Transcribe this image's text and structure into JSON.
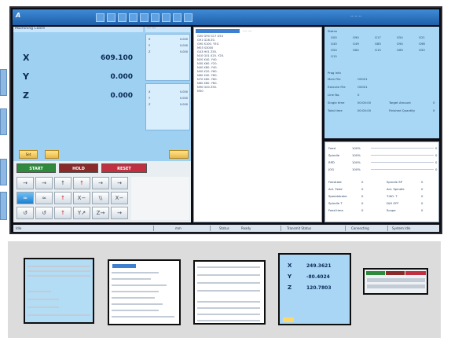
{
  "window": {
    "brand": "A",
    "toolbar_buttons": [
      "",
      "",
      "",
      "",
      "",
      "",
      "",
      "",
      ""
    ],
    "title_right": "-- -- --"
  },
  "coords": {
    "header": "Machining Coord",
    "header_right": "--- ---",
    "axes": [
      {
        "name": "X",
        "value": "609.100"
      },
      {
        "name": "Y",
        "value": "0.000"
      },
      {
        "name": "Z",
        "value": "0.000"
      }
    ],
    "sub_upper": [
      {
        "k": "X",
        "v": "0.000"
      },
      {
        "k": "Y",
        "v": "0.000"
      },
      {
        "k": "Z",
        "v": "0.000"
      }
    ],
    "sub_lower": [
      {
        "k": "X",
        "v": "0.000"
      },
      {
        "k": "Y",
        "v": "0.000"
      },
      {
        "k": "Z",
        "v": "0.000"
      }
    ],
    "btn_left1": "Set",
    "btn_left2": "",
    "btn_right": ""
  },
  "control": {
    "start": "START",
    "hold": "HOLD",
    "reset": "RESET",
    "grid_row1": [
      "→",
      "→",
      "↑",
      "↑",
      "→",
      "→"
    ],
    "grid_row2": [
      "≈",
      "≈",
      "↑",
      "X−",
      "\\\\",
      "X−"
    ],
    "grid_row3": [
      "↺",
      "↺",
      "↑",
      "Y↗",
      "Z→",
      "→"
    ]
  },
  "program": {
    "header": "---- ----",
    "lines": [
      "G00 G90 G17 G54",
      "G91 G28 Z0.",
      "G90 X100. Y50.",
      "M03 S3000",
      "G43 H01 Z50.",
      "N10 G01 X20. Y20.",
      "N20 X40. Y40.",
      "N30 X60. Y20.",
      "N40 X80. Y40.",
      "N50 X20. Y60.",
      "N60 X40. Y80.",
      "N70 X60. Y60.",
      "N80 X80. Y80.",
      "N90 G00 Z50.",
      "M30"
    ]
  },
  "right_upper": {
    "header": "Status",
    "codes_row1": [
      "G00",
      "G90",
      "G17",
      "G54",
      "G21"
    ],
    "codes_row2": [
      "G40",
      "G49",
      "G80",
      "G94",
      "G98"
    ],
    "codes_row3": [
      "G54",
      "G64",
      "G15",
      "G69",
      "G50"
    ],
    "code_last": "G15",
    "info_header": "Prog Info",
    "info_rows": [
      {
        "label": "Main File",
        "value": "O0001"
      },
      {
        "label": "Execute File",
        "value": "O0001"
      },
      {
        "label": "Line No.",
        "value": "0"
      },
      {
        "label": "Single time",
        "value": "00:00:00",
        "extra_label": "Target Amount",
        "extra_value": "0"
      },
      {
        "label": "Total time",
        "value": "00:00:00",
        "extra_label": "Finished Quantity",
        "extra_value": "0"
      }
    ]
  },
  "right_lower": {
    "bars": [
      {
        "label": "Feed",
        "value": "100%",
        "end": "0"
      },
      {
        "label": "Spindle",
        "value": "100%",
        "end": "0"
      },
      {
        "label": "RPD",
        "value": "100%",
        "end": "0"
      },
      {
        "label": "JOG",
        "value": "100%",
        "end": "0"
      }
    ],
    "rows": [
      {
        "l1": "Feedrate",
        "v1": "0",
        "l2": "Spindle SP",
        "v2": "0"
      },
      {
        "l1": "Act. Feed",
        "v1": "0",
        "l2": "Act. Spindle",
        "v2": "0"
      },
      {
        "l1": "Speedstroke",
        "v1": "0",
        "l2": "T-NO. T",
        "v2": "0"
      },
      {
        "l1": "Spindle T",
        "v1": "0",
        "l2": "D/H OFF",
        "v2": "0"
      },
      {
        "l1": "Feed time",
        "v1": "0",
        "l2": "Scope",
        "v2": "0"
      }
    ]
  },
  "statusbar": {
    "mode": "Idle",
    "unit": "mm",
    "status_label": "Status",
    "status_value": "Ready",
    "transmit_label": "Transmit Status",
    "connect_label": "Connecting",
    "system_label": "System Idle"
  },
  "thumbs": {
    "t4_values": [
      "249.3621",
      "-80.4024",
      "120.7803"
    ],
    "t4_axes": [
      "X",
      "Y",
      "Z"
    ]
  }
}
